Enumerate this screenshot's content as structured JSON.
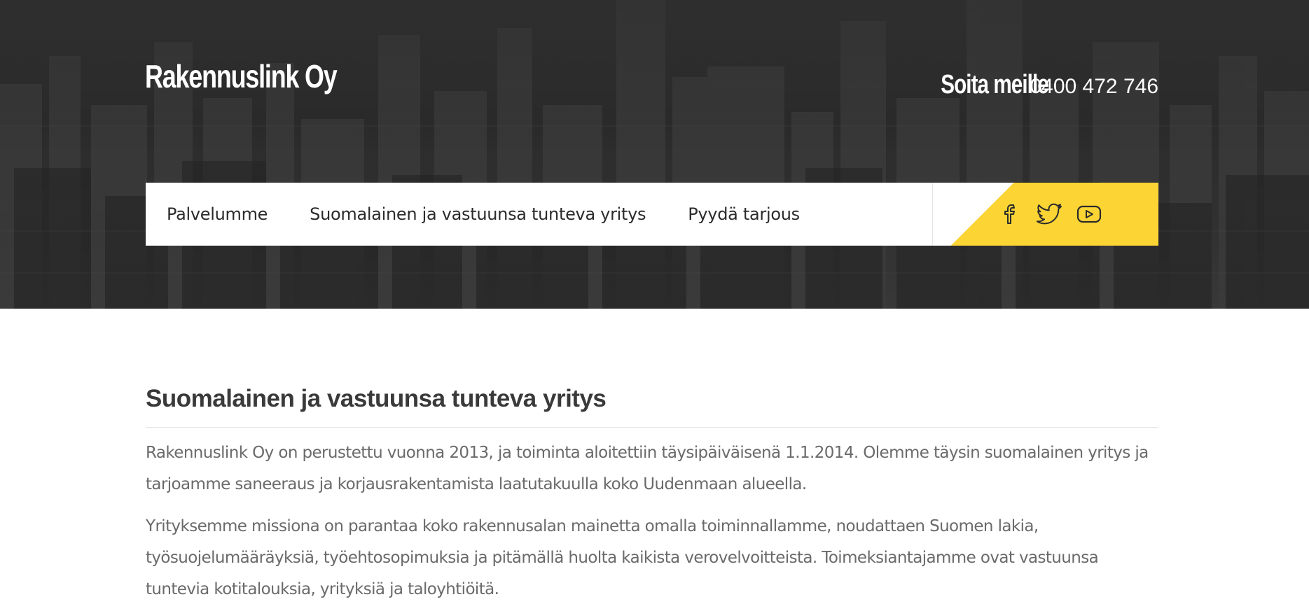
{
  "header": {
    "logo_text": "Rakennuslink Oy",
    "call_label": "Soita meille",
    "phone_number": "0400 472 746"
  },
  "nav": {
    "items": [
      {
        "label": "Palvelumme"
      },
      {
        "label": "Suomalainen ja vastuunsa tunteva yritys"
      },
      {
        "label": "Pyydä tarjous"
      }
    ],
    "social": [
      {
        "icon": "facebook-icon"
      },
      {
        "icon": "twitter-icon"
      },
      {
        "icon": "youtube-icon"
      }
    ]
  },
  "main": {
    "heading": "Suomalainen ja vastuunsa tunteva yritys",
    "paragraphs": [
      "Rakennuslink Oy on perustettu vuonna 2013, ja toiminta aloitettiin täysipäiväisenä 1.1.2014. Olemme täysin suomalainen yritys ja tarjoamme saneeraus ja korjausrakentamista laatutakuulla koko Uudenmaan alueella.",
      "Yrityksemme missiona on parantaa koko rakennusalan mainetta omalla toiminnallamme, noudattaen Suomen lakia, työsuojelumääräyksiä, työehtosopimuksia ja pitämällä huolta kaikista verovelvoitteista. Toimeksiantajamme ovat vastuunsa tuntevia kotitalouksia, yrityksiä ja taloyhtiöitä."
    ]
  },
  "colors": {
    "accent_yellow": "#fcd535",
    "hero_dark": "#333333",
    "text_body": "#6a6a6a",
    "text_heading": "#3a3a3a"
  }
}
